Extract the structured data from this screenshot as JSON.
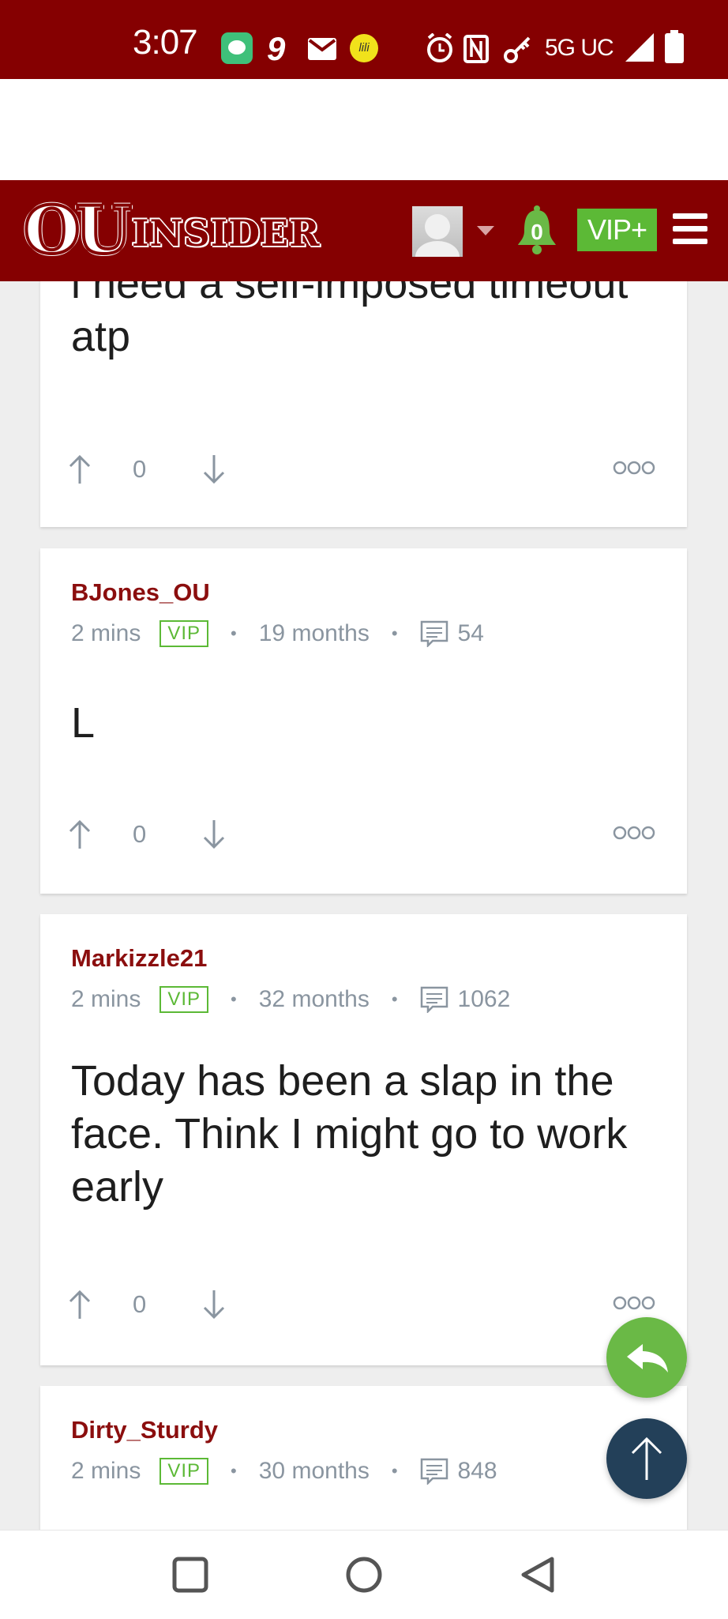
{
  "status_bar": {
    "time": "3:07",
    "network": "5G UC",
    "icons": [
      "chat-app-icon",
      "nine-icon",
      "gmail-icon",
      "lili-icon",
      "alarm-icon",
      "nfc-icon",
      "key-icon",
      "signal-icon",
      "battery-icon"
    ],
    "lili_label": "lili"
  },
  "header": {
    "logo_ou": "OU",
    "logo_insider": "INSIDER",
    "notification_count": "0",
    "vip_label": "VIP+",
    "colors": {
      "brand": "#850001",
      "accent_green": "#5cb936"
    }
  },
  "posts": [
    {
      "username": "",
      "body": "i need a self-imposed timeout atp",
      "votes": "0"
    },
    {
      "username": "BJones_OU",
      "time": "2 mins",
      "badge": "VIP",
      "tenure": "19 months",
      "post_count": "54",
      "body": "L",
      "votes": "0"
    },
    {
      "username": "Markizzle21",
      "time": "2 mins",
      "badge": "VIP",
      "tenure": "32 months",
      "post_count": "1062",
      "body": "Today has been a slap in the face. Think I might go to work early",
      "votes": "0"
    },
    {
      "username": "Dirty_Sturdy",
      "time": "2 mins",
      "badge": "VIP",
      "tenure": "30 months",
      "post_count": "848"
    }
  ],
  "fabs": {
    "reply_icon": "reply-icon",
    "scroll_top_icon": "arrow-up-icon"
  },
  "nav": {
    "buttons": [
      "recents-icon",
      "home-icon",
      "back-icon"
    ]
  }
}
